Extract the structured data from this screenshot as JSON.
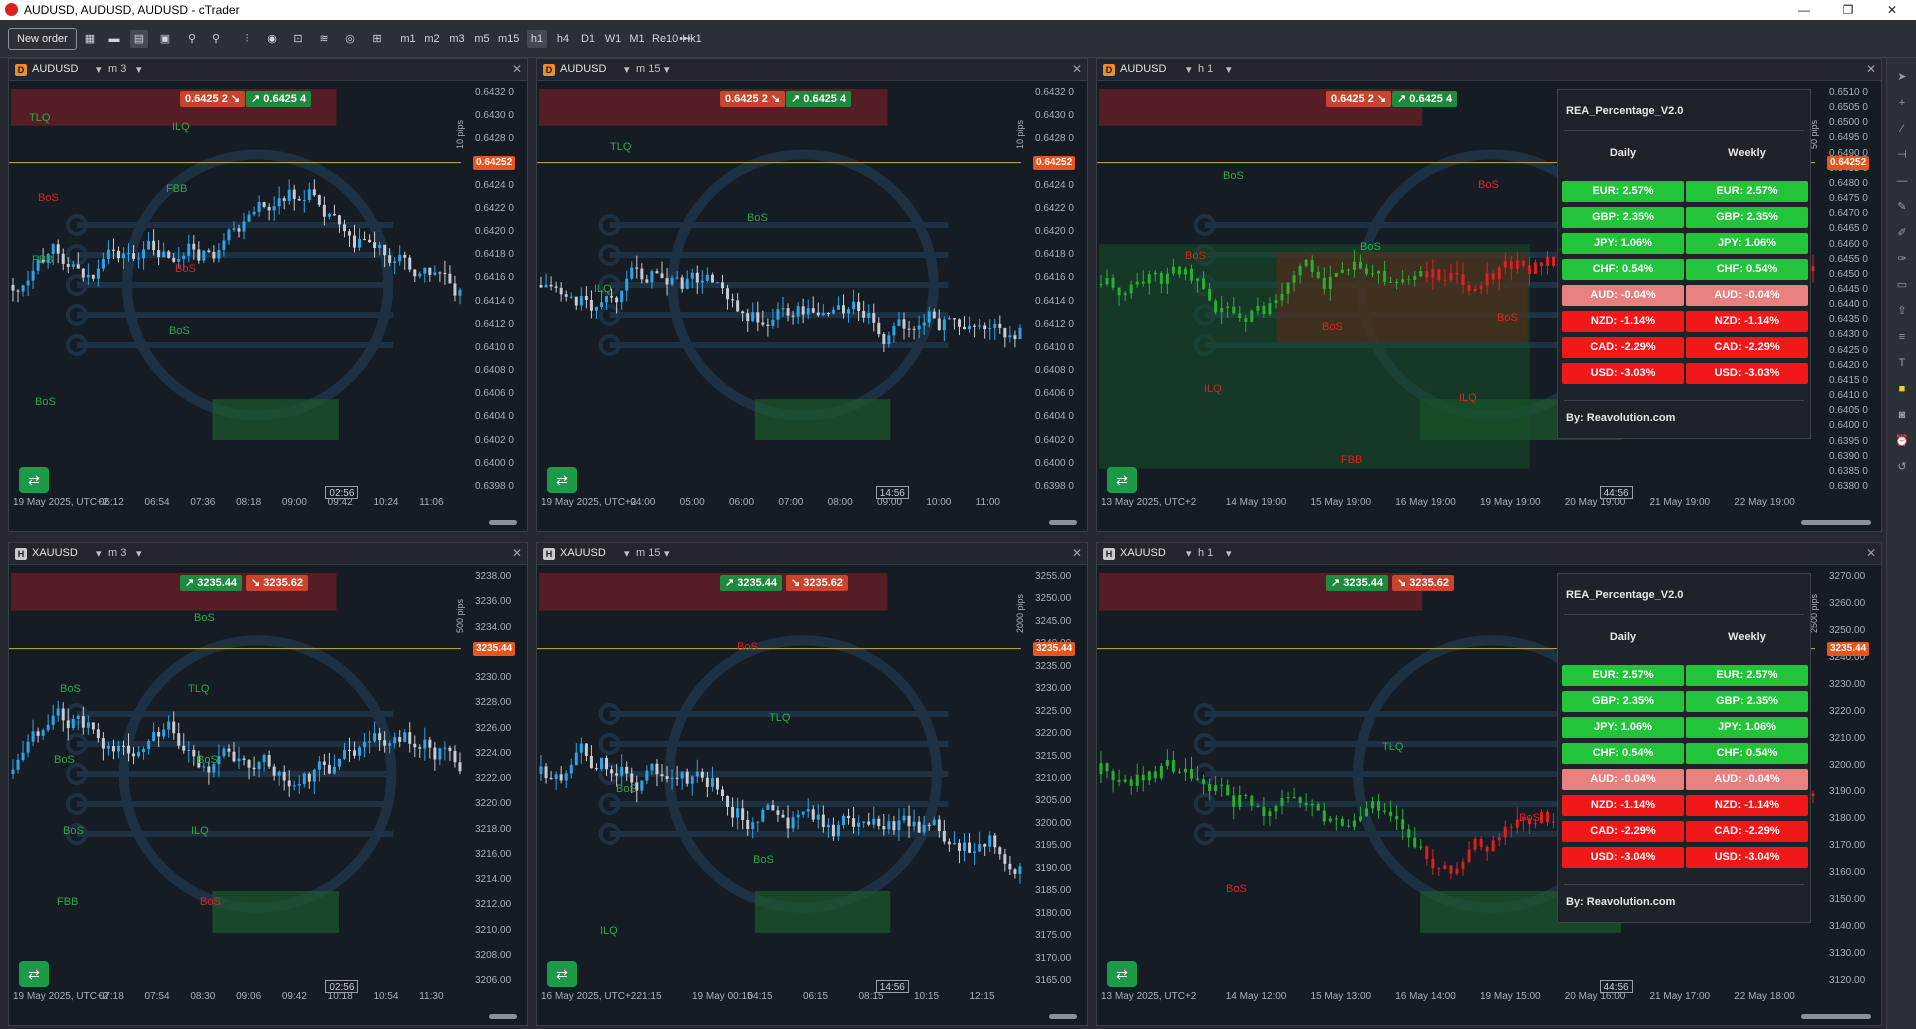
{
  "window": {
    "title": "AUDUSD, AUDUSD, AUDUSD - cTrader",
    "minimize": "—",
    "maximize": "❐",
    "close": "✕"
  },
  "toolbar": {
    "new_order": "New order",
    "timeframes": [
      "m1",
      "m2",
      "m3",
      "m5",
      "m15",
      "h1",
      "h4",
      "D1",
      "W1",
      "M1",
      "Re10",
      "Hk1"
    ],
    "more": "•••"
  },
  "panels": [
    {
      "symbol": "AUDUSD",
      "badge": "D",
      "badge_color": "#f28c28",
      "timeframe": "m 3",
      "sell": "0.6425 2",
      "buy": "0.6425 4",
      "pips_label": "10 pips",
      "price_tag": "0.64252",
      "countdown": "02:56",
      "y_ticks": [
        "0.6432 0",
        "0.6430 0",
        "0.6428 0",
        "0.6426 0",
        "0.6424 0",
        "0.6422 0",
        "0.6420 0",
        "0.6418 0",
        "0.6416 0",
        "0.6414 0",
        "0.6412 0",
        "0.6410 0",
        "0.6408 0",
        "0.6406 0",
        "0.6404 0",
        "0.6402 0",
        "0.6400 0",
        "0.6398 0"
      ],
      "x_ticks": [
        "19 May 2025, UTC+2",
        "06:12",
        "06:54",
        "07:36",
        "08:18",
        "09:00",
        "09:42",
        "10:24",
        "11:06"
      ],
      "labels": [
        {
          "t": "TLQ",
          "c": "#2fa84a"
        },
        {
          "t": "FBB",
          "c": "#2fa84a"
        },
        {
          "t": "FBB",
          "c": "#2fa84a"
        },
        {
          "t": "BoS",
          "c": "#2fa84a"
        },
        {
          "t": "BoS",
          "c": "#2fa84a"
        },
        {
          "t": "ILQ",
          "c": "#2fa84a"
        },
        {
          "t": "BoS",
          "c": "#e02020"
        },
        {
          "t": "BoS",
          "c": "#e02020"
        }
      ]
    },
    {
      "symbol": "AUDUSD",
      "badge": "D",
      "badge_color": "#f28c28",
      "timeframe": "m 15",
      "sell": "0.6425 2",
      "buy": "0.6425 4",
      "pips_label": "10 pips",
      "price_tag": "0.64252",
      "countdown": "14:56",
      "y_ticks": [
        "0.6432 0",
        "0.6430 0",
        "0.6428 0",
        "0.6426 0",
        "0.6424 0",
        "0.6422 0",
        "0.6420 0",
        "0.6418 0",
        "0.6416 0",
        "0.6414 0",
        "0.6412 0",
        "0.6410 0",
        "0.6408 0",
        "0.6406 0",
        "0.6404 0",
        "0.6402 0",
        "0.6400 0",
        "0.6398 0"
      ],
      "x_ticks": [
        "19 May 2025, UTC+2",
        "04:00",
        "05:00",
        "06:00",
        "07:00",
        "08:00",
        "09:00",
        "10:00",
        "11:00"
      ],
      "labels": [
        {
          "t": "TLQ",
          "c": "#2fa84a"
        },
        {
          "t": "BoS",
          "c": "#2fa84a"
        },
        {
          "t": "ILQ",
          "c": "#2fa84a"
        }
      ]
    },
    {
      "symbol": "AUDUSD",
      "badge": "D",
      "badge_color": "#f28c28",
      "timeframe": "h 1",
      "sell": "0.6425 2",
      "buy": "0.6425 4",
      "pips_label": "50 pips",
      "price_tag": "0.64252",
      "countdown": "44:56",
      "y_ticks": [
        "0.6510 0",
        "0.6505 0",
        "0.6500 0",
        "0.6495 0",
        "0.6490 0",
        "0.6485 0",
        "0.6480 0",
        "0.6475 0",
        "0.6470 0",
        "0.6465 0",
        "0.6460 0",
        "0.6455 0",
        "0.6450 0",
        "0.6445 0",
        "0.6440 0",
        "0.6435 0",
        "0.6430 0",
        "0.6425 0",
        "0.6420 0",
        "0.6415 0",
        "0.6410 0",
        "0.6405 0",
        "0.6400 0",
        "0.6395 0",
        "0.6390 0",
        "0.6385 0",
        "0.6380 0"
      ],
      "x_ticks": [
        "13 May 2025, UTC+2",
        "14 May 19:00",
        "15 May 19:00",
        "16 May 19:00",
        "19 May 19:00",
        "20 May 19:00",
        "21 May 19:00",
        "22 May 19:00"
      ],
      "labels": [
        {
          "t": "BoS",
          "c": "#2fa84a"
        },
        {
          "t": "BoS",
          "c": "#2fa84a"
        },
        {
          "t": "BoS",
          "c": "#e02020"
        },
        {
          "t": "ILQ",
          "c": "#e02020"
        },
        {
          "t": "FBB",
          "c": "#e02020"
        },
        {
          "t": "BoS",
          "c": "#e02020"
        },
        {
          "t": "BoS",
          "c": "#e02020"
        },
        {
          "t": "BoS",
          "c": "#e02020"
        },
        {
          "t": "ILQ",
          "c": "#e02020"
        }
      ],
      "rea": {
        "title": "REA_Percentage_V2.0",
        "daily": "Daily",
        "weekly": "Weekly",
        "rows": [
          {
            "d": "EUR: 2.57%",
            "w": "EUR: 2.57%",
            "bg": "#22c43a"
          },
          {
            "d": "GBP: 2.35%",
            "w": "GBP: 2.35%",
            "bg": "#22c43a"
          },
          {
            "d": "JPY: 1.06%",
            "w": "JPY: 1.06%",
            "bg": "#22c43a"
          },
          {
            "d": "CHF: 0.54%",
            "w": "CHF: 0.54%",
            "bg": "#22c43a"
          },
          {
            "d": "AUD: -0.04%",
            "w": "AUD: -0.04%",
            "bg": "#e88080"
          },
          {
            "d": "NZD: -1.14%",
            "w": "NZD: -1.14%",
            "bg": "#f01818"
          },
          {
            "d": "CAD: -2.29%",
            "w": "CAD: -2.29%",
            "bg": "#f01818"
          },
          {
            "d": "USD: -3.03%",
            "w": "USD: -3.03%",
            "bg": "#f01818"
          }
        ],
        "footer": "By: Reavolution.com"
      }
    },
    {
      "symbol": "XAUUSD",
      "badge": "H",
      "badge_color": "#c8ccd2",
      "timeframe": "m 3",
      "sell": "3235.62",
      "buy": "3235.44",
      "pips_label": "500 pips",
      "price_tag": "3235.44",
      "countdown": "02:56",
      "y_ticks": [
        "3238.00",
        "3236.00",
        "3234.00",
        "3232.00",
        "3230.00",
        "3228.00",
        "3226.00",
        "3224.00",
        "3222.00",
        "3220.00",
        "3218.00",
        "3216.00",
        "3214.00",
        "3212.00",
        "3210.00",
        "3208.00",
        "3206.00"
      ],
      "x_ticks": [
        "19 May 2025, UTC+2",
        "07:18",
        "07:54",
        "08:30",
        "09:06",
        "09:42",
        "10:18",
        "10:54",
        "11:30"
      ],
      "labels": [
        {
          "t": "TLQ",
          "c": "#2fa84a"
        },
        {
          "t": "BoS",
          "c": "#2fa84a"
        },
        {
          "t": "ILQ",
          "c": "#2fa84a"
        },
        {
          "t": "FBB",
          "c": "#2fa84a"
        },
        {
          "t": "BoS",
          "c": "#2fa84a"
        },
        {
          "t": "BoS",
          "c": "#2fa84a"
        },
        {
          "t": "BoS",
          "c": "#2fa84a"
        },
        {
          "t": "BoS",
          "c": "#2fa84a"
        },
        {
          "t": "BoS",
          "c": "#e02020"
        }
      ]
    },
    {
      "symbol": "XAUUSD",
      "badge": "H",
      "badge_color": "#c8ccd2",
      "timeframe": "m 15",
      "sell": "3235.62",
      "buy": "3235.44",
      "pips_label": "2000 pips",
      "price_tag": "3235.44",
      "countdown": "14:56",
      "y_ticks": [
        "3255.00",
        "3250.00",
        "3245.00",
        "3240.00",
        "3235.00",
        "3230.00",
        "3225.00",
        "3220.00",
        "3215.00",
        "3210.00",
        "3205.00",
        "3200.00",
        "3195.00",
        "3190.00",
        "3185.00",
        "3180.00",
        "3175.00",
        "3170.00",
        "3165.00"
      ],
      "x_ticks": [
        "16 May 2025, UTC+2",
        "21:15",
        "19 May 00:15",
        "04:15",
        "06:15",
        "08:15",
        "10:15",
        "12:15"
      ],
      "labels": [
        {
          "t": "TLQ",
          "c": "#2fa84a"
        },
        {
          "t": "BoS",
          "c": "#2fa84a"
        },
        {
          "t": "BoS",
          "c": "#2fa84a"
        },
        {
          "t": "ILQ",
          "c": "#2fa84a"
        },
        {
          "t": "BoS",
          "c": "#e02020"
        }
      ]
    },
    {
      "symbol": "XAUUSD",
      "badge": "H",
      "badge_color": "#c8ccd2",
      "timeframe": "h 1",
      "sell": "3235.62",
      "buy": "3235.44",
      "pips_label": "2500 pips",
      "price_tag": "3235.44",
      "countdown": "44:56",
      "y_ticks": [
        "3270.00",
        "3260.00",
        "3250.00",
        "3240.00",
        "3230.00",
        "3220.00",
        "3210.00",
        "3200.00",
        "3190.00",
        "3180.00",
        "3170.00",
        "3160.00",
        "3150.00",
        "3140.00",
        "3130.00",
        "3120.00"
      ],
      "x_ticks": [
        "13 May 2025, UTC+2",
        "14 May 12:00",
        "15 May 13:00",
        "16 May 14:00",
        "19 May 15:00",
        "20 May 16:00",
        "21 May 17:00",
        "22 May 18:00"
      ],
      "labels": [
        {
          "t": "TLQ",
          "c": "#2fa84a"
        },
        {
          "t": "BoS",
          "c": "#e02020"
        },
        {
          "t": "BoS",
          "c": "#e02020"
        }
      ],
      "rea": {
        "title": "REA_Percentage_V2.0",
        "daily": "Daily",
        "weekly": "Weekly",
        "rows": [
          {
            "d": "EUR: 2.57%",
            "w": "EUR: 2.57%",
            "bg": "#22c43a"
          },
          {
            "d": "GBP: 2.35%",
            "w": "GBP: 2.35%",
            "bg": "#22c43a"
          },
          {
            "d": "JPY: 1.06%",
            "w": "JPY: 1.06%",
            "bg": "#22c43a"
          },
          {
            "d": "CHF: 0.54%",
            "w": "CHF: 0.54%",
            "bg": "#22c43a"
          },
          {
            "d": "AUD: -0.04%",
            "w": "AUD: -0.04%",
            "bg": "#e88080"
          },
          {
            "d": "NZD: -1.14%",
            "w": "NZD: -1.14%",
            "bg": "#f01818"
          },
          {
            "d": "CAD: -2.29%",
            "w": "CAD: -2.29%",
            "bg": "#f01818"
          },
          {
            "d": "USD: -3.04%",
            "w": "USD: -3.04%",
            "bg": "#f01818"
          }
        ],
        "footer": "By: Reavolution.com"
      }
    }
  ]
}
